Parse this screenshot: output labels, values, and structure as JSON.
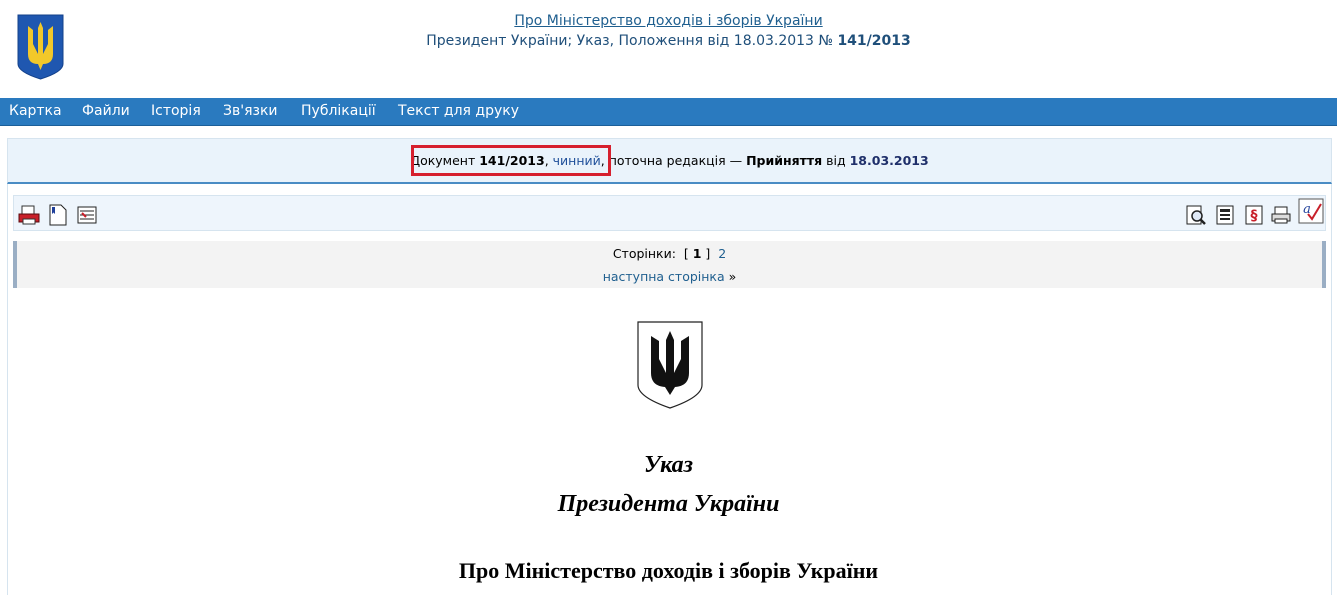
{
  "header": {
    "title": "Про Міністерство доходів і зборів України",
    "subtitle_prefix": "Президент України; Указ, Положення від 18.03.2013 № ",
    "doc_number": "141/2013"
  },
  "nav": {
    "items": [
      "Картка",
      "Файли",
      "Історія",
      "Зв'язки",
      "Публікації",
      "Текст для друку"
    ]
  },
  "status": {
    "label": "Документ ",
    "number": "141/2013",
    "sep": ", ",
    "state": "чинний",
    "rest": ", поточна редакція — ",
    "event": "Прийняття",
    "from": " від ",
    "date": "18.03.2013"
  },
  "toolbar": {
    "left_icons": [
      "print-icon",
      "document-icon",
      "compare-icon"
    ],
    "right_icons": [
      "search-icon",
      "notes-icon",
      "section-icon",
      "printer-icon",
      "spellcheck-icon"
    ]
  },
  "pager": {
    "label": "Сторінки:",
    "current": "1",
    "other": "2",
    "next": "наступна сторінка",
    "next_arrow": "»"
  },
  "document": {
    "line1": "Указ",
    "line2": "Президента України",
    "line3": "Про Міністерство доходів і зборів України"
  },
  "colors": {
    "nav_bg": "#2a7abf",
    "highlight": "#d6202e",
    "link": "#1f5f8f"
  }
}
